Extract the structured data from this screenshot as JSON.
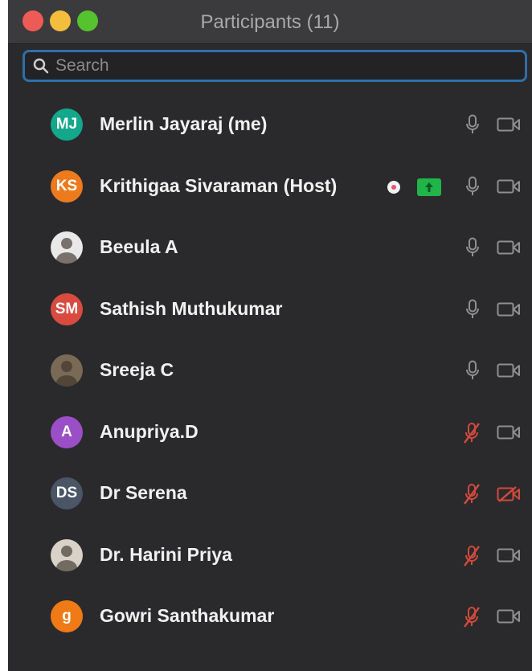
{
  "window": {
    "title": "Participants (11)"
  },
  "search": {
    "placeholder": "Search"
  },
  "participants": [
    {
      "initials": "MJ",
      "name": "Merlin Jayaraj (me)",
      "avatar_color": "#13a78c",
      "avatar_kind": "initials",
      "mic": "on",
      "video": "on"
    },
    {
      "initials": "KS",
      "name": "Krithigaa Sivaraman (Host)",
      "avatar_color": "#ed7b1d",
      "avatar_kind": "initials",
      "mic": "on",
      "video": "on",
      "sharing": true
    },
    {
      "initials": "",
      "name": "Beeula A",
      "avatar_color": "#e9e9e9",
      "avatar_kind": "photo",
      "mic": "on",
      "video": "on"
    },
    {
      "initials": "SM",
      "name": "Sathish Muthukumar",
      "avatar_color": "#d94b3f",
      "avatar_kind": "initials",
      "mic": "on",
      "video": "on"
    },
    {
      "initials": "",
      "name": "Sreeja C",
      "avatar_color": "#7a6a55",
      "avatar_kind": "photo",
      "mic": "on",
      "video": "on"
    },
    {
      "initials": "A",
      "name": "Anupriya.D",
      "avatar_color": "#9b4fc6",
      "avatar_kind": "initials",
      "mic": "muted",
      "video": "on"
    },
    {
      "initials": "DS",
      "name": "Dr Serena",
      "avatar_color": "#4a5566",
      "avatar_kind": "initials",
      "mic": "muted",
      "video": "off"
    },
    {
      "initials": "",
      "name": "Dr. Harini Priya",
      "avatar_color": "#d9d2c8",
      "avatar_kind": "photo",
      "mic": "muted",
      "video": "on"
    },
    {
      "initials": "g",
      "name": "Gowri Santhakumar",
      "avatar_color": "#ef7a16",
      "avatar_kind": "initials",
      "mic": "muted",
      "video": "on"
    }
  ],
  "colors": {
    "accent": "#2f6fa8",
    "muted": "#d14a3c",
    "icon": "#8f8f92"
  }
}
